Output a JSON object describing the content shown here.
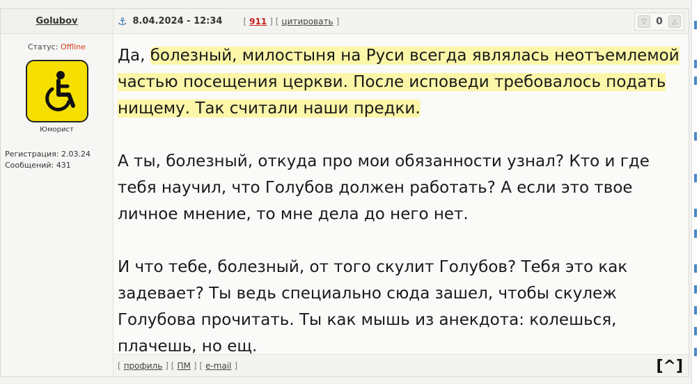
{
  "user": {
    "name": "Golubov",
    "status_label": "Статус:",
    "status_value": "Offline",
    "rank": "Юморист",
    "registration": "Регистрация: 2.03.24",
    "messages": "Сообщений: 431"
  },
  "post": {
    "date": "8.04.2024 - 12:34",
    "number": "911",
    "quote_label": "цитировать",
    "rating": "0",
    "para1_plain": "Да, ",
    "para1_highlight": "болезный, милостыня на Руси всегда являлась неотъемлемой частью посещения церкви. После исповеди требовалось подать нищему. Так считали наши предки.",
    "para2": "А ты, болезный, откуда про мои обязанности узнал? Кто и где тебя научил, что Голубов должен работать? А если это твое личное мнение, то мне дела до него нет.",
    "para3": "И что тебе, болезный, от того скулит Голубов? Тебя это как задевает? Ты ведь специально сюда зашел, чтобы скулеж Голубова прочитать. Ты как мышь из анекдота: колешься, плачешь, но ещ."
  },
  "footer": {
    "profile": "профиль",
    "pm": "ПМ",
    "email": "e-mail",
    "top": "[^]"
  },
  "colors": {
    "offline": "#d03a1f",
    "post_number": "#c71e1e",
    "highlight": "#fbf6a8",
    "avatar_bg": "#f5df00"
  }
}
